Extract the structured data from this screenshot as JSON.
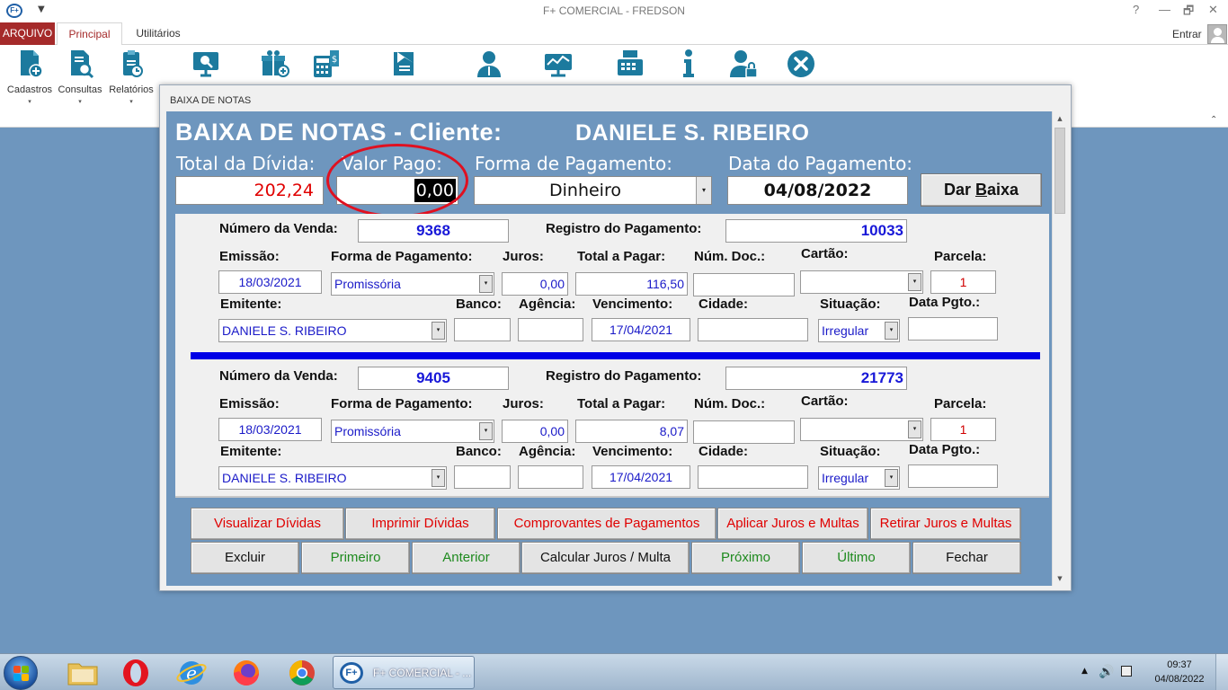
{
  "window": {
    "title": "F+ COMERCIAL - FREDSON",
    "logo_text": "F+",
    "help": "?",
    "minimize": "—",
    "restore": "🗗",
    "close": "✕",
    "qa_arrow": "▼"
  },
  "ribbon_tabs": {
    "arquivo": "ARQUIVO",
    "principal": "Principal",
    "utilitarios": "Utilitários",
    "entrar": "Entrar"
  },
  "ribbon": {
    "cadastros": "Cadastros",
    "consultas": "Consultas",
    "relatorios": "Relatórios",
    "dropdown_arrow": "▾",
    "collapse": "⌃"
  },
  "dialog": {
    "title": "BAIXA DE NOTAS",
    "header_title": "BAIXA DE NOTAS - Cliente:",
    "client_name": "DANIELE S. RIBEIRO",
    "labels": {
      "total_divida": "Total da Dívida:",
      "valor_pago": "Valor Pago:",
      "forma_pagamento": "Forma de Pagamento:",
      "data_pagamento": "Data do Pagamento:"
    },
    "total_divida": "202,24",
    "valor_pago": "0,00",
    "forma_pagamento": "Dinheiro",
    "data_pagamento": "04/08/2022",
    "dar_baixa_prefix": "Dar ",
    "dar_baixa_u": "B",
    "dar_baixa_suffix": "aixa",
    "dd_arrow": "▾"
  },
  "field_labels": {
    "numero_venda": "Número da Venda:",
    "registro_pagamento": "Registro do Pagamento:",
    "emissao": "Emissão:",
    "forma_pagamento": "Forma de Pagamento:",
    "juros": "Juros:",
    "total_pagar": "Total a Pagar:",
    "num_doc": "Núm. Doc.:",
    "cartao": "Cartão:",
    "parcela": "Parcela:",
    "emitente": "Emitente:",
    "banco": "Banco:",
    "agencia": "Agência:",
    "vencimento": "Vencimento:",
    "cidade": "Cidade:",
    "situacao": "Situação:",
    "data_pgto": "Data Pgto.:"
  },
  "records": [
    {
      "numero_venda": "9368",
      "registro_pagamento": "10033",
      "emissao": "18/03/2021",
      "forma_pagamento": "Promissória",
      "juros": "0,00",
      "total_pagar": "116,50",
      "num_doc": "",
      "cartao": "",
      "parcela": "1",
      "emitente": "DANIELE S. RIBEIRO",
      "banco": "",
      "agencia": "",
      "vencimento": "17/04/2021",
      "cidade": "",
      "situacao": "Irregular",
      "data_pgto": ""
    },
    {
      "numero_venda": "9405",
      "registro_pagamento": "21773",
      "emissao": "18/03/2021",
      "forma_pagamento": "Promissória",
      "juros": "0,00",
      "total_pagar": "8,07",
      "num_doc": "",
      "cartao": "",
      "parcela": "1",
      "emitente": "DANIELE S. RIBEIRO",
      "banco": "",
      "agencia": "",
      "vencimento": "17/04/2021",
      "cidade": "",
      "situacao": "Irregular",
      "data_pgto": ""
    }
  ],
  "buttons": {
    "visualizar_dividas": "Visualizar Dívidas",
    "imprimir_dividas": "Imprimir Dívidas",
    "comprovantes": "Comprovantes de Pagamentos",
    "aplicar_juros": "Aplicar Juros e Multas",
    "retirar_juros": "Retirar Juros e Multas",
    "excluir": "Excluir",
    "primeiro": "Primeiro",
    "anterior": "Anterior",
    "calcular": "Calcular Juros / Multa",
    "proximo": "Próximo",
    "ultimo": "Último",
    "fechar": "Fechar"
  },
  "scroll": {
    "up": "▲",
    "down": "▼"
  },
  "taskbar": {
    "task_logo": "F+",
    "task_label": "F+ COMERCIAL - ...",
    "tray_arrow": "▲",
    "speaker": "🔊",
    "time": "09:37",
    "date": "04/08/2022"
  },
  "colors": {
    "accent_red": "#a52a2a",
    "desktop_blue": "#6e96be",
    "value_blue": "#1a1ac8",
    "total_red": "#e00000",
    "button_green": "#1e8a1e"
  }
}
